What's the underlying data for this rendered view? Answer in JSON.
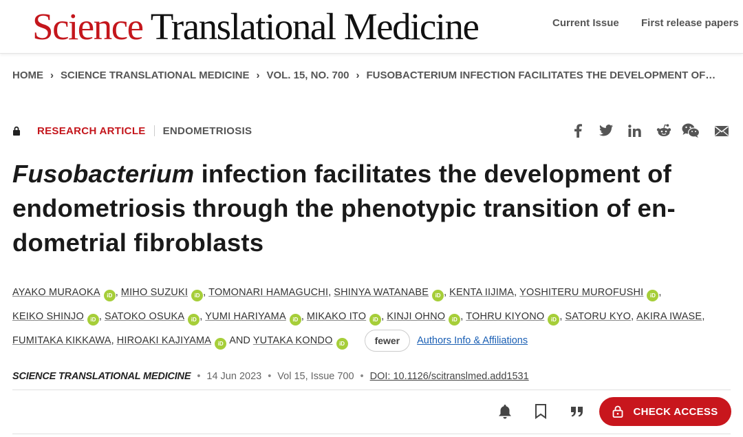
{
  "header": {
    "logo_science": "Science",
    "logo_rest": " Translational Medicine",
    "nav": [
      "Current Issue",
      "First release papers"
    ]
  },
  "breadcrumb": [
    "HOME",
    "SCIENCE TRANSLATIONAL MEDICINE",
    "VOL. 15, NO. 700",
    "FUSOBACTERIUM INFECTION FACILITATES THE DEVELOPMENT OF…"
  ],
  "article": {
    "type": "RESEARCH ARTICLE",
    "subject": "ENDOMETRIOSIS",
    "title_italic": "Fusobacterium",
    "title_rest": " infection facilitates the development of endometriosis through the phenotypic transition of en-dometrial fibroblasts",
    "authors_line1": [
      {
        "name": "AYAKO MURAOKA",
        "orcid": true
      },
      {
        "name": "MIHO SUZUKI",
        "orcid": true
      },
      {
        "name": "TOMONARI HAMAGUCHI",
        "orcid": false
      },
      {
        "name": "SHINYA WATANABE",
        "orcid": true
      },
      {
        "name": "KENTA IIJIMA",
        "orcid": false
      },
      {
        "name": "YOSHITERU MUROFUSHI",
        "orcid": true
      }
    ],
    "authors_line2": [
      {
        "name": "KEIKO SHINJO",
        "orcid": true
      },
      {
        "name": "SATOKO OSUKA",
        "orcid": true
      },
      {
        "name": "YUMI HARIYAMA",
        "orcid": true
      },
      {
        "name": "MIKAKO ITO",
        "orcid": true
      },
      {
        "name": "KINJI OHNO",
        "orcid": true
      },
      {
        "name": "TOHRU KIYONO",
        "orcid": true
      },
      {
        "name": "SATORU KYO",
        "orcid": false
      },
      {
        "name": "AKIRA IWASE",
        "orcid": false
      }
    ],
    "authors_line3": [
      {
        "name": "FUMITAKA KIKKAWA",
        "orcid": false
      },
      {
        "name": "HIROAKI KAJIYAMA",
        "orcid": true
      }
    ],
    "and_text": "AND",
    "last_author": "YUTAKA KONDO",
    "fewer_label": "fewer",
    "affil_label": "Authors Info & Affiliations",
    "journal": "SCIENCE TRANSLATIONAL MEDICINE",
    "date": "14 Jun 2023",
    "volume": "Vol 15, Issue 700",
    "doi": "DOI: 10.1126/scitranslmed.add1531"
  },
  "orcid_label": "iD",
  "share_icons": [
    "facebook-icon",
    "twitter-icon",
    "linkedin-icon",
    "reddit-icon",
    "wechat-icon",
    "email-icon"
  ],
  "actions": {
    "check_access": "CHECK ACCESS"
  },
  "colors": {
    "brand_red": "#c4161c",
    "orcid_green": "#a6ce39",
    "link_blue": "#1a5fb4"
  }
}
